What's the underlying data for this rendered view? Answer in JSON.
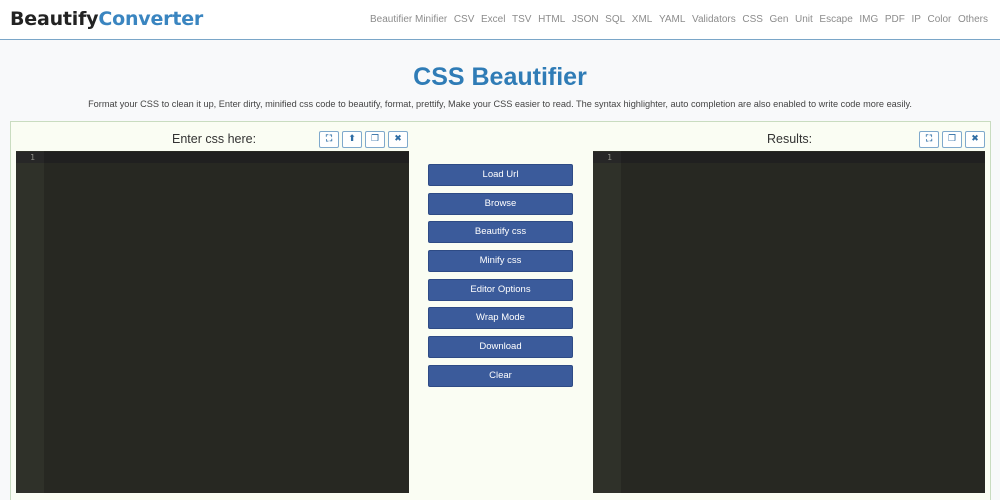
{
  "header": {
    "logo_part1": "Beautify",
    "logo_part2": "Converter",
    "nav": [
      "Beautifier Minifier",
      "CSV",
      "Excel",
      "TSV",
      "HTML",
      "JSON",
      "SQL",
      "XML",
      "YAML",
      "Validators",
      "CSS",
      "Gen",
      "Unit",
      "Escape",
      "IMG",
      "PDF",
      "IP",
      "Color",
      "Others"
    ]
  },
  "page": {
    "title": "CSS Beautifier",
    "description": "Format your CSS to clean it up, Enter dirty, minified css code to beautify, format, prettify, Make your CSS easier to read. The syntax highlighter, auto completion are also enabled to write code more easily."
  },
  "input_editor": {
    "label": "Enter css here:",
    "line_number": "1",
    "icons": [
      "fullscreen-icon",
      "upload-icon",
      "copy-icon",
      "close-icon"
    ]
  },
  "output_editor": {
    "label": "Results:",
    "line_number": "1",
    "icons": [
      "fullscreen-icon",
      "copy-icon",
      "close-icon"
    ]
  },
  "actions": [
    "Load Url",
    "Browse",
    "Beautify css",
    "Minify css",
    "Editor Options",
    "Wrap Mode",
    "Download",
    "Clear"
  ],
  "colors": {
    "brand": "#3a85c0",
    "button": "#3b5b9b",
    "editor_bg": "#272822"
  }
}
